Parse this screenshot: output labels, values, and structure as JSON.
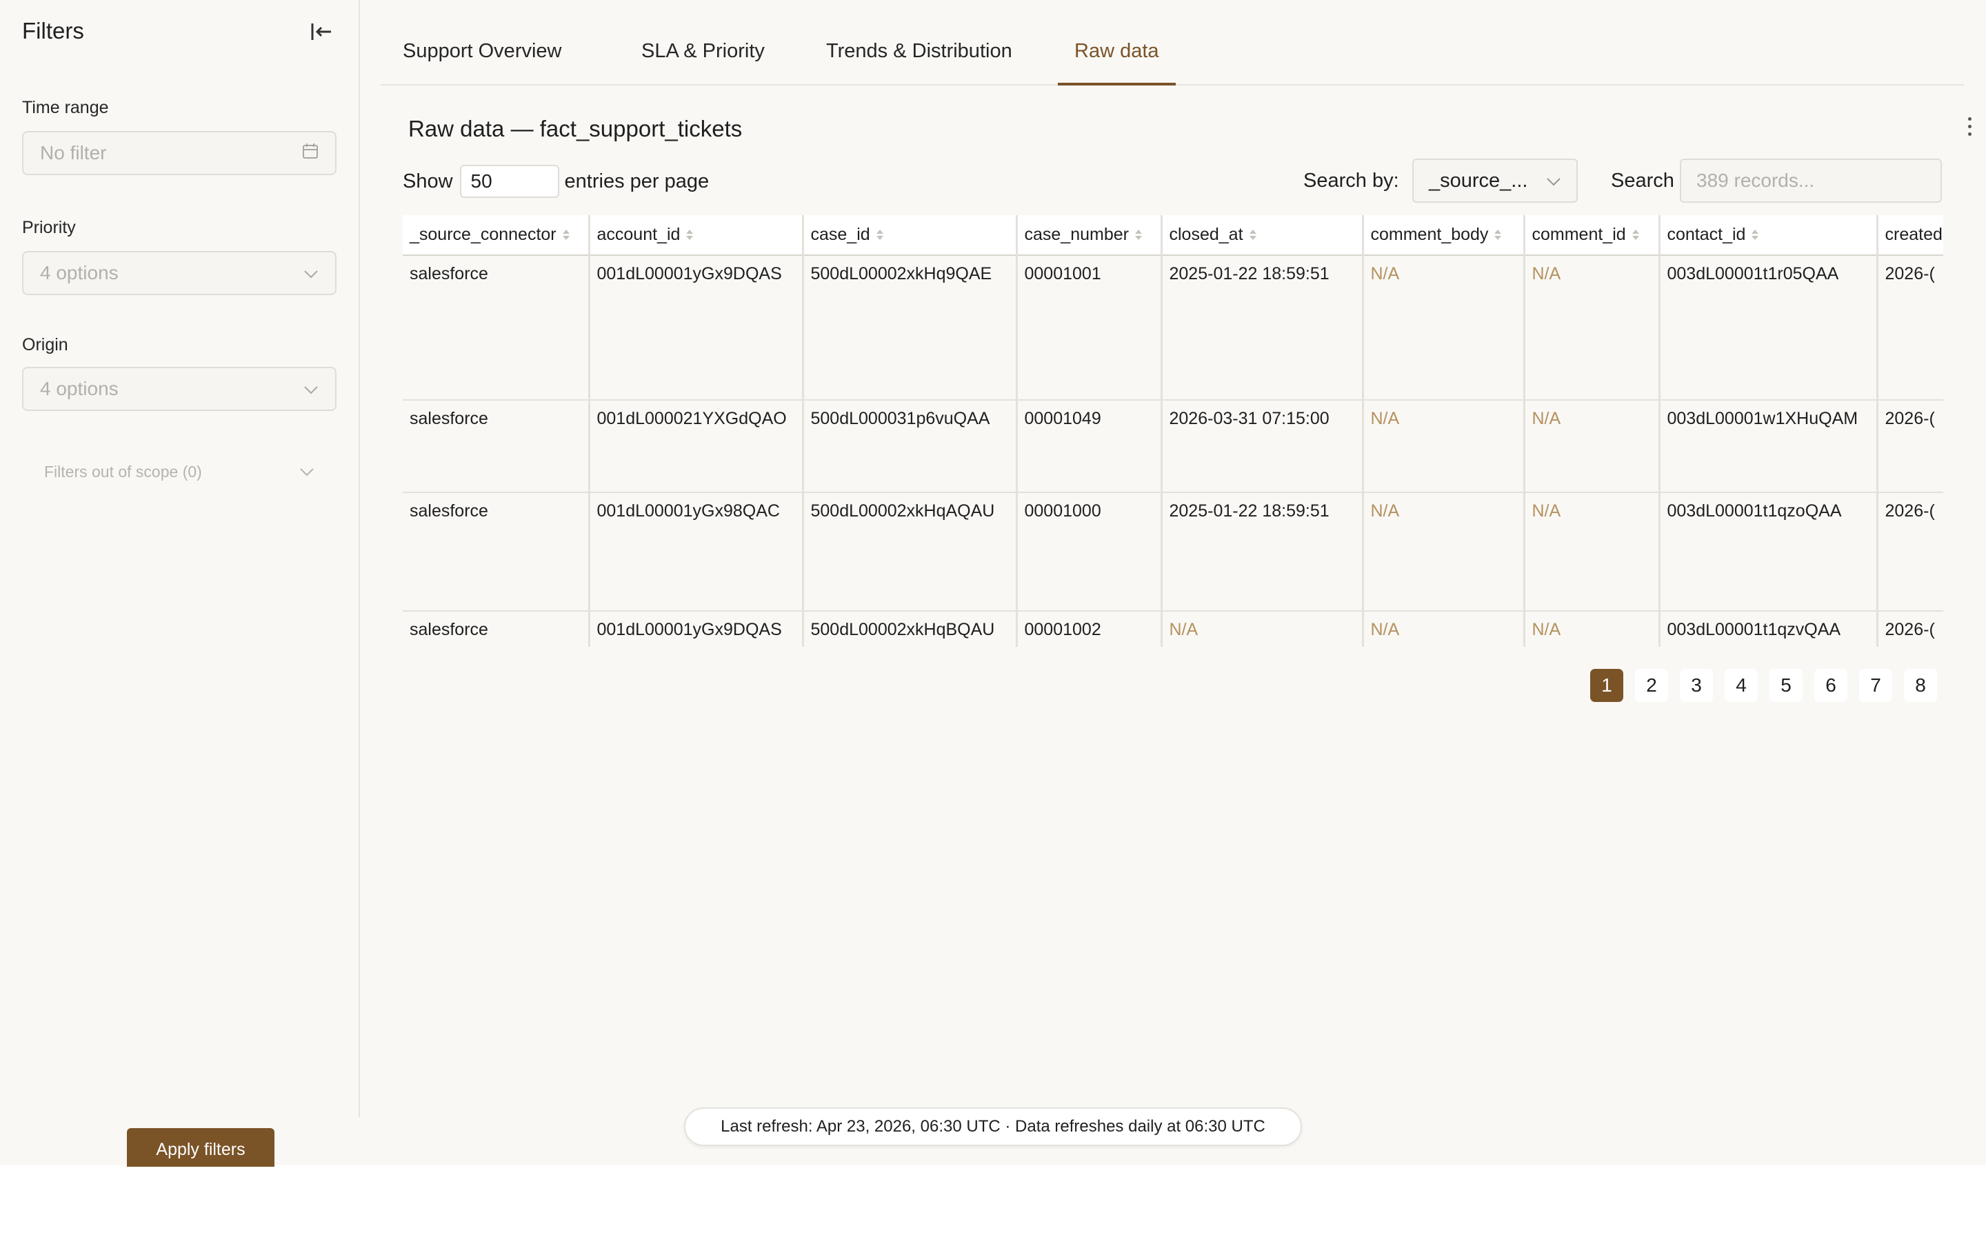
{
  "sidebar": {
    "title": "Filters",
    "time_range": {
      "label": "Time range",
      "placeholder": "No filter"
    },
    "priority": {
      "label": "Priority",
      "placeholder": "4 options"
    },
    "origin": {
      "label": "Origin",
      "placeholder": "4 options"
    },
    "out_of_scope": "Filters out of scope (0)",
    "apply_label": "Apply filters"
  },
  "tabs": [
    {
      "label": "Support Overview",
      "active": false
    },
    {
      "label": "SLA & Priority",
      "active": false
    },
    {
      "label": "Trends & Distribution",
      "active": false
    },
    {
      "label": "Raw data",
      "active": true
    }
  ],
  "panel": {
    "title": "Raw data — fact_support_tickets",
    "show_label": "Show",
    "entries_value": "50",
    "entries_suffix": "entries per page",
    "search_by_label": "Search by:",
    "search_by_value": "_source_...",
    "search_label": "Search",
    "search_placeholder": "389 records..."
  },
  "table": {
    "columns": [
      "_source_connector",
      "account_id",
      "case_id",
      "case_number",
      "closed_at",
      "comment_body",
      "comment_id",
      "contact_id",
      "created"
    ],
    "rows": [
      [
        "salesforce",
        "001dL00001yGx9DQAS",
        "500dL00002xkHq9QAE",
        "00001001",
        "2025-01-22 18:59:51",
        "N/A",
        "N/A",
        "003dL00001t1r05QAA",
        "2026-("
      ],
      [
        "salesforce",
        "001dL000021YXGdQAO",
        "500dL000031p6vuQAA",
        "00001049",
        "2026-03-31 07:15:00",
        "N/A",
        "N/A",
        "003dL00001w1XHuQAM",
        "2026-("
      ],
      [
        "salesforce",
        "001dL00001yGx98QAC",
        "500dL00002xkHqAQAU",
        "00001000",
        "2025-01-22 18:59:51",
        "N/A",
        "N/A",
        "003dL00001t1qzoQAA",
        "2026-("
      ],
      [
        "salesforce",
        "001dL00001yGx9DQAS",
        "500dL00002xkHqBQAU",
        "00001002",
        "N/A",
        "N/A",
        "N/A",
        "003dL00001t1qzvQAA",
        "2026-("
      ]
    ]
  },
  "pagination": {
    "pages": [
      "1",
      "2",
      "3",
      "4",
      "5",
      "6",
      "7",
      "8"
    ],
    "current": "1"
  },
  "footer": {
    "refresh_text": "Last refresh: Apr 23, 2026, 06:30 UTC · Data refreshes daily at 06:30 UTC"
  },
  "colors": {
    "accent": "#7a5327",
    "na_text": "#b5915f",
    "background": "#f9f8f5"
  },
  "icons": [
    "collapse-sidebar-icon",
    "calendar-icon",
    "chevron-down-icon",
    "sort-icon",
    "kebab-menu-icon"
  ]
}
